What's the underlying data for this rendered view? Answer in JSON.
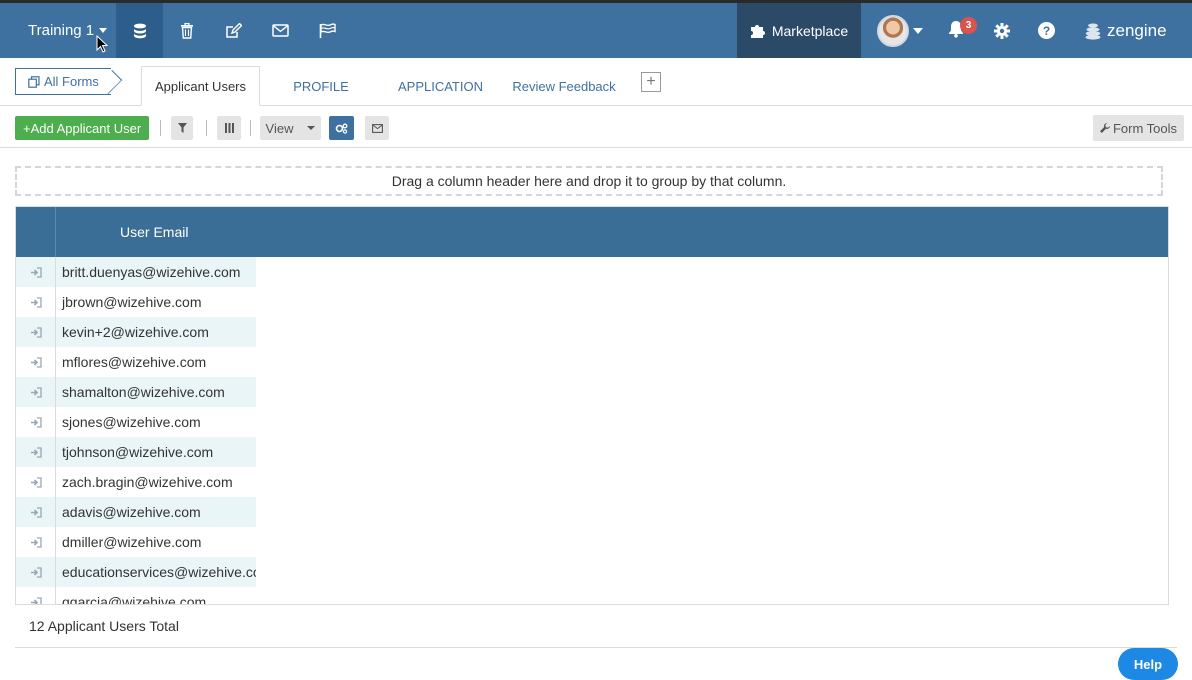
{
  "navbar": {
    "workspace": "Training 1",
    "marketplace": "Marketplace",
    "notification_count": "3",
    "help_glyph": "?",
    "brand": "zengine",
    "icons": [
      "database-icon",
      "trash-icon",
      "edit-icon",
      "mail-icon",
      "flag-icon"
    ],
    "colors": {
      "bar": "#3e71a0",
      "active": "#2d5d8a",
      "marketplace": "#2b4a68",
      "badge": "#d9534f"
    }
  },
  "tabs": {
    "all_forms": "All Forms",
    "items": [
      {
        "label": "Applicant Users",
        "active": true
      },
      {
        "label": "PROFILE",
        "active": false
      },
      {
        "label": "APPLICATION",
        "active": false
      },
      {
        "label": "Review Feedback",
        "active": false
      }
    ],
    "add_glyph": "+"
  },
  "toolbar": {
    "add_label": "+Add Applicant User",
    "view_label": "View",
    "form_tools_label": "Form Tools"
  },
  "grid": {
    "group_hint": "Drag a column header here and drop it to group by that column.",
    "column_header": "User Email",
    "rows": [
      "britt.duenyas@wizehive.com",
      "jbrown@wizehive.com",
      "kevin+2@wizehive.com",
      "mflores@wizehive.com",
      "shamalton@wizehive.com",
      "sjones@wizehive.com",
      "tjohnson@wizehive.com",
      "zach.bragin@wizehive.com",
      "adavis@wizehive.com",
      "dmiller@wizehive.com",
      "educationservices@wizehive.com",
      "ggarcia@wizehive.com"
    ],
    "header_color": "#3a6e96",
    "alt_row_color": "#e9f5f7"
  },
  "footer": {
    "total": "12 Applicant Users Total",
    "help_button": "Help"
  }
}
